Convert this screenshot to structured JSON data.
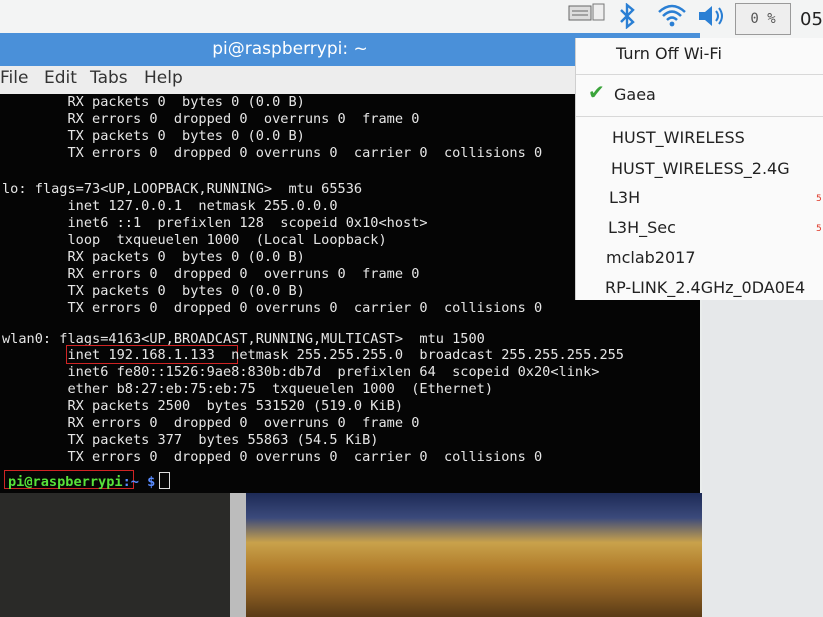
{
  "panel": {
    "cpu_label": "0 %",
    "clock": "05:",
    "icons": [
      "keyboard-icon",
      "bluetooth-icon",
      "wifi-icon",
      "volume-icon"
    ],
    "accent": "#1a73e8"
  },
  "window": {
    "title": "pi@raspberrypi: ~",
    "menu": [
      "File",
      "Edit",
      "Tabs",
      "Help"
    ]
  },
  "terminal": {
    "lines": [
      "        RX packets 0  bytes 0 (0.0 B)",
      "        RX errors 0  dropped 0  overruns 0  frame 0",
      "        TX packets 0  bytes 0 (0.0 B)",
      "        TX errors 0  dropped 0 overruns 0  carrier 0  collisions 0",
      "",
      "lo: flags=73<UP,LOOPBACK,RUNNING>  mtu 65536",
      "        inet 127.0.0.1  netmask 255.0.0.0",
      "        inet6 ::1  prefixlen 128  scopeid 0x10<host>",
      "        loop  txqueuelen 1000  (Local Loopback)",
      "        RX packets 0  bytes 0 (0.0 B)",
      "        RX errors 0  dropped 0  overruns 0  frame 0",
      "        TX packets 0  bytes 0 (0.0 B)",
      "        TX errors 0  dropped 0 overruns 0  carrier 0  collisions 0",
      "",
      "wlan0: flags=4163<UP,BROADCAST,RUNNING,MULTICAST>  mtu 1500",
      "        inet 192.168.1.133  netmask 255.255.255.0  broadcast 255.255.255.255",
      "        inet6 fe80::1526:9ae8:830b:db7d  prefixlen 64  scopeid 0x20<link>",
      "        ether b8:27:eb:75:eb:75  txqueuelen 1000  (Ethernet)",
      "        RX packets 2500  bytes 531520 (519.0 KiB)",
      "        RX errors 0  dropped 0  overruns 0  frame 0",
      "        TX packets 377  bytes 55863 (54.5 KiB)",
      "        TX errors 0  dropped 0 overruns 0  carrier 0  collisions 0"
    ],
    "prompt_user": "pi@raspberrypi",
    "prompt_path": ":~ $"
  },
  "wifi_menu": {
    "turn_off": "Turn Off Wi-Fi",
    "connected": "Gaea",
    "networks": [
      "HUST_WIRELESS",
      "HUST_WIRELESS_2.4G",
      "L3H",
      "L3H_Sec",
      "mclab2017",
      "RP-LINK_2.4GHz_0DA0E4"
    ]
  }
}
